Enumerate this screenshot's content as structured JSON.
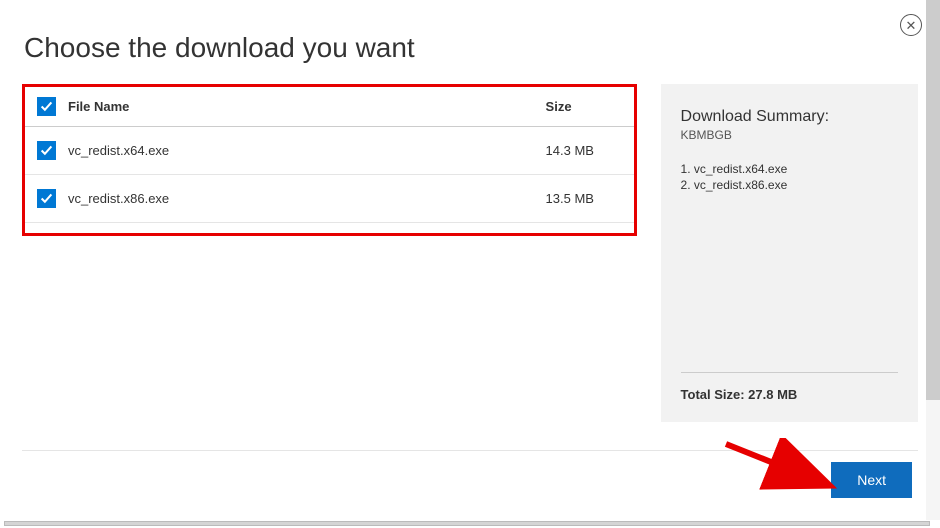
{
  "title": "Choose the download you want",
  "table": {
    "header_checked": true,
    "col_name": "File Name",
    "col_size": "Size",
    "rows": [
      {
        "checked": true,
        "name": "vc_redist.x64.exe",
        "size": "14.3 MB"
      },
      {
        "checked": true,
        "name": "vc_redist.x86.exe",
        "size": "13.5 MB"
      }
    ]
  },
  "summary": {
    "title": "Download Summary:",
    "meta": "KBMBGB",
    "items": [
      "1. vc_redist.x64.exe",
      "2. vc_redist.x86.exe"
    ],
    "total_label": "Total Size: 27.8 MB"
  },
  "next_label": "Next"
}
